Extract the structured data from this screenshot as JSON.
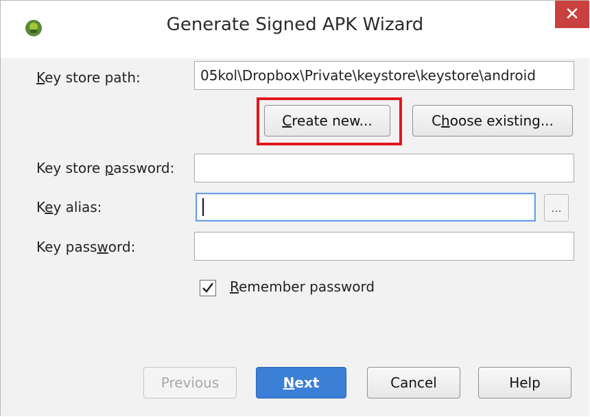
{
  "window": {
    "title": "Generate Signed APK Wizard",
    "close_glyph": "✕",
    "app_icon": "android-studio-icon"
  },
  "form": {
    "key_store_path": {
      "label_accel": "K",
      "label_rest": "ey store path:",
      "value": "05kol\\Dropbox\\Private\\keystore\\keystore\\android"
    },
    "create_new": {
      "accel": "C",
      "rest": "reate new..."
    },
    "choose_existing": {
      "pre": "C",
      "accel": "h",
      "rest": "oose existing..."
    },
    "key_store_password": {
      "label_pre": "Key store ",
      "label_accel": "p",
      "label_rest": "assword:",
      "value": ""
    },
    "key_alias": {
      "label_pre": "K",
      "label_accel": "e",
      "label_rest": "y alias:",
      "value": "",
      "browse_label": "..."
    },
    "key_password": {
      "label_pre": "Key pass",
      "label_accel": "w",
      "label_rest": "ord:",
      "value": ""
    },
    "remember_password": {
      "accel": "R",
      "rest": "emember password",
      "checked": true
    }
  },
  "footer": {
    "previous": "Previous",
    "next_accel": "N",
    "next_rest": "ext",
    "cancel": "Cancel",
    "help": "Help"
  },
  "colors": {
    "highlight": "#e3161e",
    "primary": "#3b7fd6",
    "close": "#c9413e",
    "focus": "#6aa0e8"
  }
}
